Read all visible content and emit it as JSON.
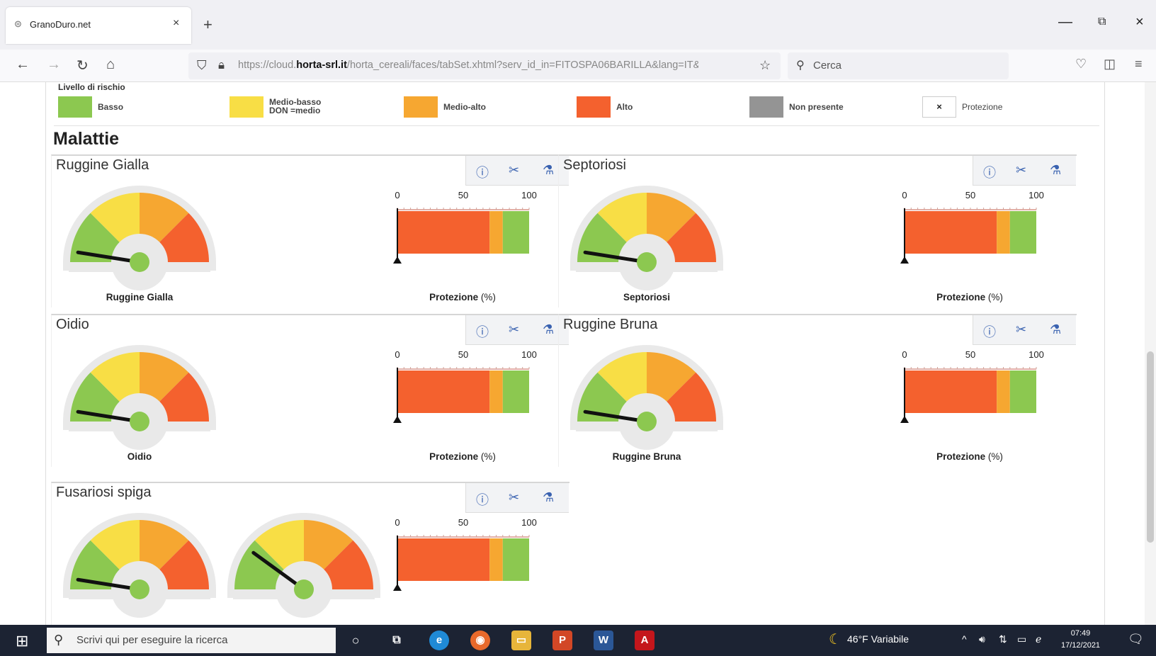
{
  "browser": {
    "tab_title": "GranoDuro.net",
    "url_prefix": "https://cloud.",
    "url_domain": "horta-srl.it",
    "url_path": "/horta_cereali/faces/tabSet.xhtml?serv_id_in=FITOSPA06BARILLA&lang=IT&",
    "search_placeholder": "Cerca"
  },
  "legend": {
    "title": "Livello di rischio",
    "items": [
      {
        "label": "Basso",
        "color": "#8cc850"
      },
      {
        "label_line1": "Medio-basso",
        "label_line2": "DON =medio",
        "color": "#f8de45"
      },
      {
        "label": "Medio-alto",
        "color": "#f6a731"
      },
      {
        "label": "Alto",
        "color": "#f4612e"
      },
      {
        "label": "Non presente",
        "color": "#949494"
      },
      {
        "label": "Protezione",
        "symbol": "×"
      }
    ]
  },
  "section_title": "Malattie",
  "panels": [
    {
      "title": "Ruggine Gialla",
      "gauge_label": "Ruggine Gialla",
      "bar_label": "Protezione",
      "bar_unit": "(%)",
      "gauge_value": 0.05
    },
    {
      "title": "Septoriosi",
      "gauge_label": "Septoriosi",
      "bar_label": "Protezione",
      "bar_unit": "(%)",
      "gauge_value": 0.05
    },
    {
      "title": "Oidio",
      "gauge_label": "Oidio",
      "bar_label": "Protezione",
      "bar_unit": "(%)",
      "gauge_value": 0.05
    },
    {
      "title": "Ruggine Bruna",
      "gauge_label": "Ruggine Bruna",
      "bar_label": "Protezione",
      "bar_unit": "(%)",
      "gauge_value": 0.05
    },
    {
      "title": "Fusariosi spiga",
      "gauge_value": 0.05,
      "gauge2_value": 0.2
    }
  ],
  "protection_bar": {
    "ticks": [
      "0",
      "50",
      "100"
    ],
    "segments": [
      {
        "to": 70,
        "color": "#f4612e"
      },
      {
        "to": 80,
        "color": "#f6a731"
      },
      {
        "to": 100,
        "color": "#8cc850"
      }
    ]
  },
  "gauge_colors": [
    "#8cc850",
    "#f8de45",
    "#f6a731",
    "#f4612e"
  ],
  "taskbar": {
    "search_placeholder": "Scrivi qui per eseguire la ricerca",
    "weather": "46°F  Variabile",
    "time": "07:49",
    "date": "17/12/2021"
  }
}
